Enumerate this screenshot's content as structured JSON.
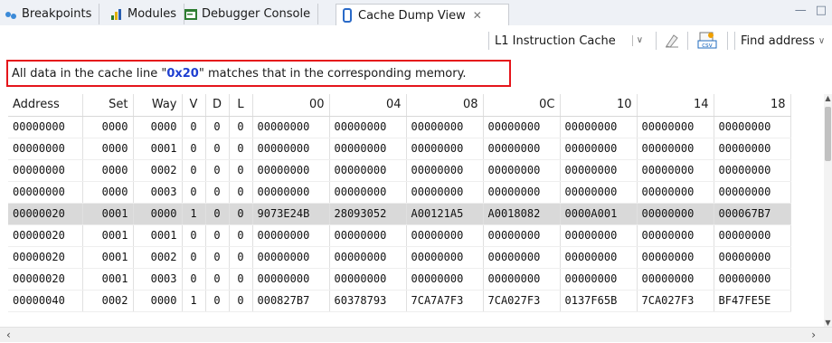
{
  "tabs": [
    {
      "label": "Breakpoints",
      "icon": "breakpoints-icon"
    },
    {
      "label": "Modules",
      "icon": "modules-icon"
    },
    {
      "label": "Debugger Console",
      "icon": "debugger-console-icon"
    },
    {
      "label": "Cache Dump View",
      "icon": "cache-dump-icon",
      "close": "✕"
    }
  ],
  "toolbar": {
    "cache_type": "L1 Instruction Cache",
    "find_address": "Find address"
  },
  "status": {
    "prefix": "All data in the cache line \"",
    "line": "0x20",
    "suffix": "\" matches that in the corresponding memory."
  },
  "table": {
    "headers": [
      "Address",
      "Set",
      "Way",
      "V",
      "D",
      "L",
      "00",
      "04",
      "08",
      "0C",
      "10",
      "14",
      "18"
    ],
    "rows": [
      [
        "00000000",
        "0000",
        "0000",
        "0",
        "0",
        "0",
        "00000000",
        "00000000",
        "00000000",
        "00000000",
        "00000000",
        "00000000",
        "00000000"
      ],
      [
        "00000000",
        "0000",
        "0001",
        "0",
        "0",
        "0",
        "00000000",
        "00000000",
        "00000000",
        "00000000",
        "00000000",
        "00000000",
        "00000000"
      ],
      [
        "00000000",
        "0000",
        "0002",
        "0",
        "0",
        "0",
        "00000000",
        "00000000",
        "00000000",
        "00000000",
        "00000000",
        "00000000",
        "00000000"
      ],
      [
        "00000000",
        "0000",
        "0003",
        "0",
        "0",
        "0",
        "00000000",
        "00000000",
        "00000000",
        "00000000",
        "00000000",
        "00000000",
        "00000000"
      ],
      [
        "00000020",
        "0001",
        "0000",
        "1",
        "0",
        "0",
        "9073E24B",
        "28093052",
        "A00121A5",
        "A0018082",
        "0000A001",
        "00000000",
        "000067B7"
      ],
      [
        "00000020",
        "0001",
        "0001",
        "0",
        "0",
        "0",
        "00000000",
        "00000000",
        "00000000",
        "00000000",
        "00000000",
        "00000000",
        "00000000"
      ],
      [
        "00000020",
        "0001",
        "0002",
        "0",
        "0",
        "0",
        "00000000",
        "00000000",
        "00000000",
        "00000000",
        "00000000",
        "00000000",
        "00000000"
      ],
      [
        "00000020",
        "0001",
        "0003",
        "0",
        "0",
        "0",
        "00000000",
        "00000000",
        "00000000",
        "00000000",
        "00000000",
        "00000000",
        "00000000"
      ],
      [
        "00000040",
        "0002",
        "0000",
        "1",
        "0",
        "0",
        "000827B7",
        "60378793",
        "7CA7A7F3",
        "7CA027F3",
        "0137F65B",
        "7CA027F3",
        "BF47FE5E"
      ]
    ],
    "selected_row": 4
  },
  "colors": {
    "highlight_box": "#e5151b",
    "highlight_text": "#1f3fd1",
    "selected_row": "#d9d9d9"
  }
}
